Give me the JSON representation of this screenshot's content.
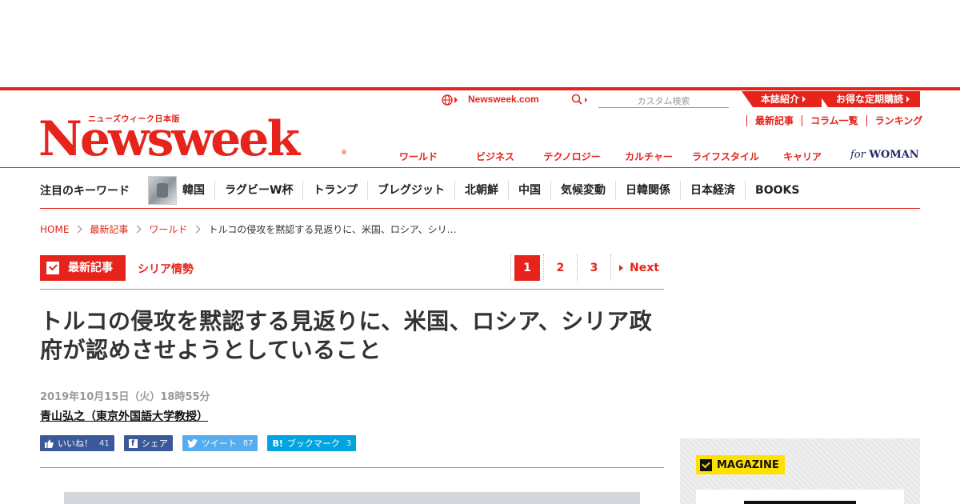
{
  "colors": {
    "brand_red": "#e6241b",
    "yellow": "#ffe100",
    "facebook": "#3b5998",
    "twitter": "#55acee",
    "hatena": "#00a4de"
  },
  "header": {
    "logo_text": "Newsweek",
    "logo_sub": "ニューズウィーク日本版",
    "site_link": "Newsweek.com",
    "search_placeholder": "カスタム検索",
    "top_tabs": [
      "本誌紹介",
      "お得な定期購読"
    ],
    "sub_links": [
      "最新記事",
      "コラム一覧",
      "ランキング"
    ],
    "categories": [
      "ワールド",
      "ビジネス",
      "テクノロジー",
      "カルチャー",
      "ライフスタイル",
      "キャリア"
    ],
    "for_woman": {
      "for": "for",
      "woman": "WOMAN"
    }
  },
  "keywords": {
    "title": "注目のキーワード",
    "items": [
      "韓国",
      "ラグビーW杯",
      "トランプ",
      "ブレグジット",
      "北朝鮮",
      "中国",
      "気候変動",
      "日韓関係",
      "日本経済",
      "BOOKS"
    ]
  },
  "breadcrumb": [
    "HOME",
    "最新記事",
    "ワールド",
    "トルコの侵攻を黙認する見返りに、米国、ロシア、シリ…"
  ],
  "category": {
    "badge": "最新記事",
    "sub": "シリア情勢"
  },
  "pagination": {
    "pages": [
      "1",
      "2",
      "3"
    ],
    "current": "1",
    "next": "Next"
  },
  "article": {
    "headline": "トルコの侵攻を黙認する見返りに、米国、ロシア、シリア政府が認めさせようとしていること",
    "date": "2019年10月15日（火）18時55分",
    "author": "青山弘之（東京外国語大学教授）"
  },
  "social": {
    "like": {
      "label": "いいね！",
      "count": "41"
    },
    "share": {
      "label": "シェア"
    },
    "tweet": {
      "label": "ツイート",
      "count": "87"
    },
    "bookmark": {
      "label": "ブックマーク",
      "count": "3"
    }
  },
  "sidebar": {
    "magazine_label": "MAGAZINE"
  },
  "icons": [
    "globe-icon",
    "search-icon",
    "check-icon",
    "thumbs-up-icon",
    "facebook-icon",
    "twitter-icon",
    "hatena-icon"
  ]
}
